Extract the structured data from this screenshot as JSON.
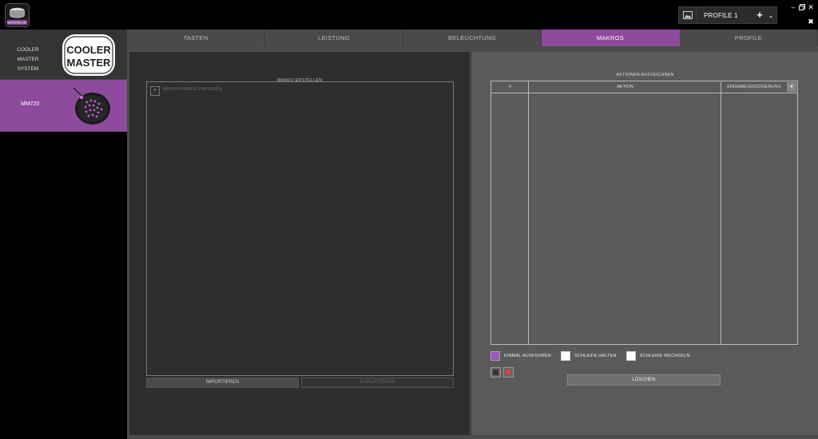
{
  "app": {
    "logo_text": "MASTERPLUS+",
    "profile": {
      "name": "PROFILE 1"
    }
  },
  "sidebar": {
    "system_label": "COOLER MASTER SYSTEM",
    "brand_logo_lines": [
      "COOLER",
      "MASTER"
    ],
    "device_label": "MM720"
  },
  "tabs": [
    {
      "label": "TASTEN",
      "active": false
    },
    {
      "label": "LEISTUNG",
      "active": false
    },
    {
      "label": "BELEUCHTUNG",
      "active": false
    },
    {
      "label": "MAKROS",
      "active": true
    },
    {
      "label": "PROFILE",
      "active": false
    }
  ],
  "macro_panel": {
    "title": "MAKRO ERSTELLEN",
    "add_label": "+",
    "name_placeholder": "MAKRONAMEN EINGEBEN",
    "import_label": "IMPORTIEREN",
    "export_label": "EXPORTIEREN"
  },
  "actions_panel": {
    "title": "AKTIONEN AUFZEICHNEN",
    "columns": {
      "index": "#",
      "action": "AKTION",
      "delay": "EINGABEVERZÖGERUNG"
    },
    "rows": [],
    "options": [
      {
        "label": "EINMAL AUSFÜHREN",
        "checked": true
      },
      {
        "label": "SCHLEIFE HALTEN",
        "checked": false
      },
      {
        "label": "SCHLEIFE WECHSELN",
        "checked": false
      }
    ],
    "delete_label": "LÖSCHEN"
  },
  "colors": {
    "accent": "#8e4a9c",
    "record_red": "#e04040"
  }
}
